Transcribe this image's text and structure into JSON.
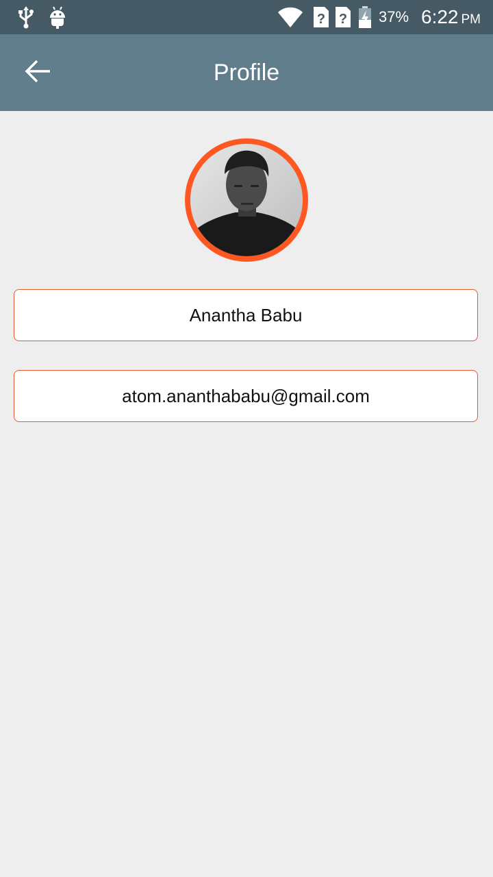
{
  "status_bar": {
    "icons": [
      "usb-icon",
      "android-icon",
      "wifi-icon",
      "sim-unknown-icon",
      "sim-unknown-icon",
      "battery-charging-icon"
    ],
    "battery_percent": "37%",
    "time": "6:22",
    "ampm": "PM"
  },
  "app_bar": {
    "back_icon": "arrow-back-icon",
    "title": "Profile",
    "background": "#607d8b"
  },
  "profile": {
    "avatar_ring_color": "#ff5722",
    "name": "Anantha Babu",
    "email": "atom.ananthababu@gmail.com"
  },
  "colors": {
    "status_bar": "#455a64",
    "page_background": "#eeeeee",
    "field_border": "#e65a2e"
  }
}
